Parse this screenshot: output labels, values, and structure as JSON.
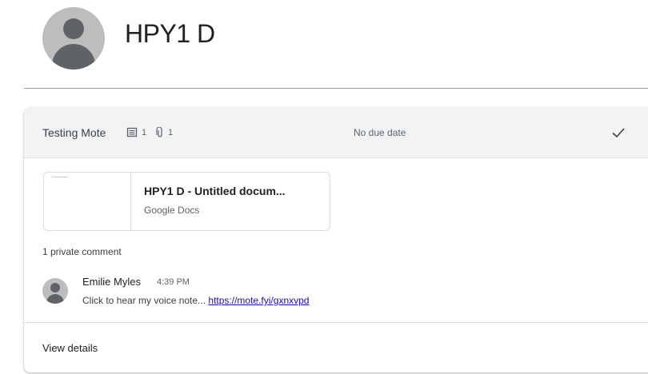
{
  "student": {
    "name": "HPY1 D"
  },
  "submission": {
    "assignment_title": "Testing Mote",
    "comment_count": "1",
    "attachment_count": "1",
    "due": "No due date",
    "status_icon": "checkmark-icon"
  },
  "attachment": {
    "title": "HPY1 D - Untitled docum...",
    "type": "Google Docs"
  },
  "comments": {
    "label": "1 private comment",
    "items": [
      {
        "author": "Emilie Myles",
        "time": "4:39 PM",
        "text": "Click to hear my voice note... ",
        "link": "https://mote.fyi/gxnxvpd"
      }
    ]
  },
  "footer": {
    "view_details": "View details"
  }
}
